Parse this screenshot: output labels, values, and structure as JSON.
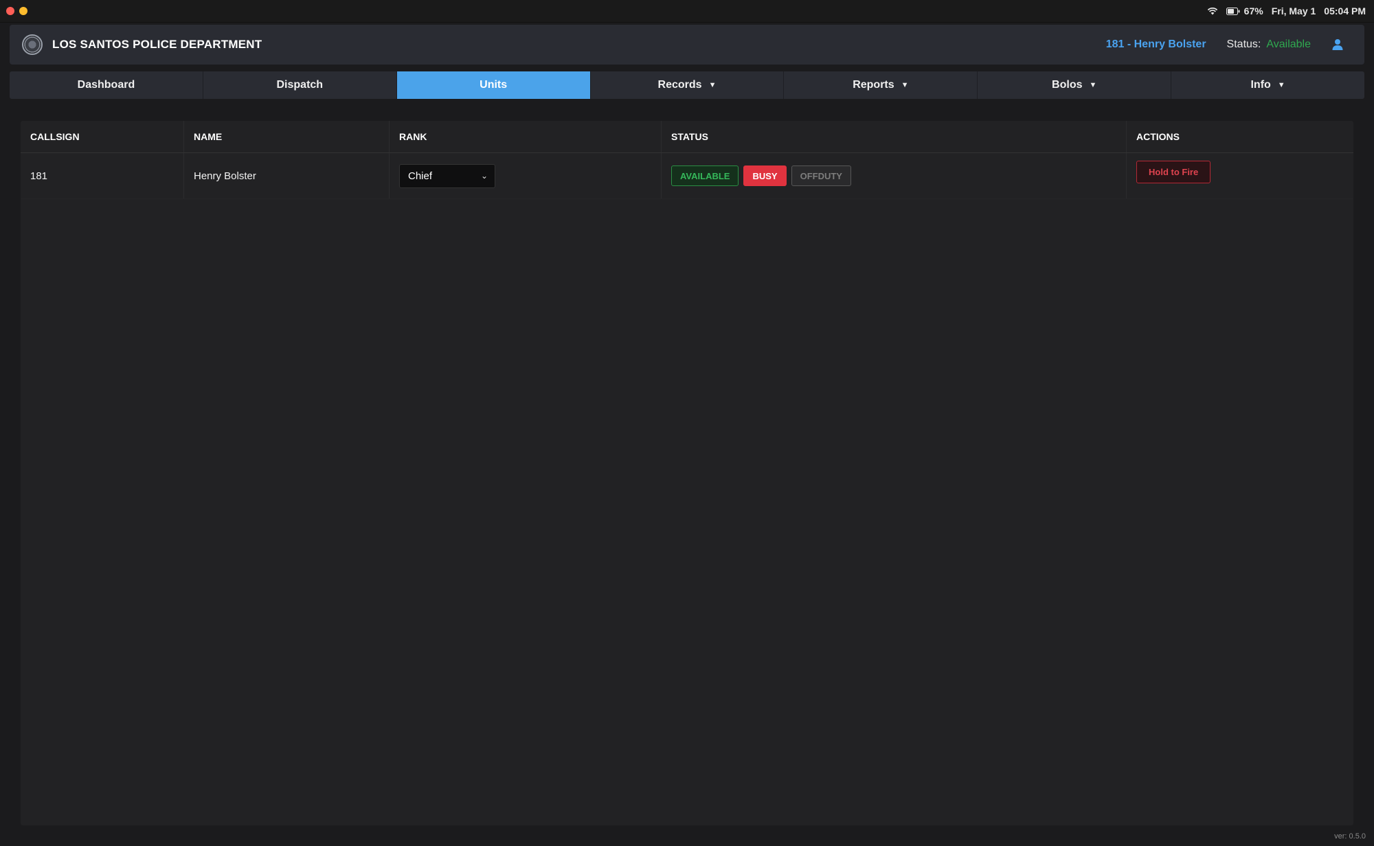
{
  "system_bar": {
    "battery_percent": "67%",
    "date": "Fri, May 1",
    "time": "05:04 PM",
    "icons": [
      "wifi-icon",
      "battery-icon"
    ]
  },
  "header": {
    "title": "LOS SANTOS POLICE DEPARTMENT",
    "logo_icon": "seal-icon",
    "officer": "181 - Henry Bolster",
    "status_label": "Status:",
    "status_value": "Available",
    "user_icon": "user-icon"
  },
  "tabs": [
    {
      "label": "Dashboard",
      "dropdown": false,
      "active": false
    },
    {
      "label": "Dispatch",
      "dropdown": false,
      "active": false
    },
    {
      "label": "Units",
      "dropdown": false,
      "active": true
    },
    {
      "label": "Records",
      "dropdown": true,
      "active": false
    },
    {
      "label": "Reports",
      "dropdown": true,
      "active": false
    },
    {
      "label": "Bolos",
      "dropdown": true,
      "active": false
    },
    {
      "label": "Info",
      "dropdown": true,
      "active": false
    }
  ],
  "caret_glyph": "▼",
  "table": {
    "columns": [
      "CALLSIGN",
      "NAME",
      "RANK",
      "STATUS",
      "ACTIONS"
    ],
    "rows": [
      {
        "callsign": "181",
        "name": "Henry Bolster",
        "rank": "Chief",
        "status_buttons": {
          "available": "AVAILABLE",
          "busy": "BUSY",
          "offduty": "OFFDUTY"
        },
        "active_status": "BUSY",
        "action": "Hold to Fire"
      }
    ]
  },
  "version": "ver: 0.5.0",
  "colors": {
    "accent": "#4ba3ea",
    "officer_text": "#4aa3f0",
    "available": "#35b85a",
    "busy": "#e0333f",
    "fire": "#e0434f"
  }
}
